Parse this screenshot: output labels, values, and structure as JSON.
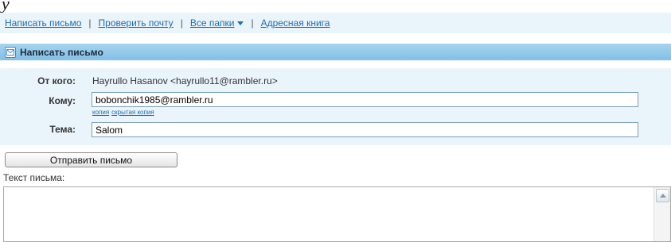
{
  "nav": {
    "compose": "Написать письмо",
    "check_mail": "Проверить почту",
    "all_folders": "Все папки",
    "address_book": "Адресная книга",
    "separator": "|"
  },
  "section": {
    "title": "Написать письмо",
    "icon": "envelope-icon"
  },
  "form": {
    "from_label": "От кого:",
    "from_value": "Hayrullo Hasanov <hayrullo11@rambler.ru>",
    "to_label": "Кому:",
    "to_value": "bobonchik1985@rambler.ru",
    "cc_link": "копия",
    "bcc_link": "скрытая копия",
    "subject_label": "Тема:",
    "subject_value": "Salom"
  },
  "send_button": "Отправить письмо",
  "body_label": "Текст письма:",
  "body_value": "",
  "colors": {
    "link": "#1f6cae",
    "panel_bg": "#eaf4fb",
    "section_bar": "#94c9eb"
  }
}
